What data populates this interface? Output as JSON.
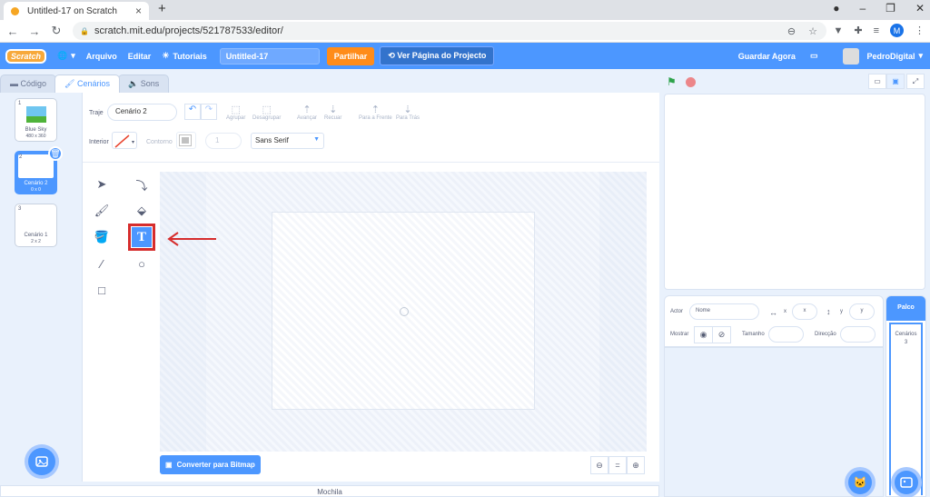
{
  "browser": {
    "tab_title": "Untitled-17 on Scratch",
    "url": "scratch.mit.edu/projects/521787533/editor/",
    "profile_initial": "M"
  },
  "menu": {
    "logo": "Scratch",
    "file": "Arquivo",
    "edit": "Editar",
    "tutorials": "Tutoriais",
    "project_title": "Untitled-17",
    "share": "Partilhar",
    "project_page": "Ver Página do Projecto",
    "save_now": "Guardar Agora",
    "username": "PedroDigital"
  },
  "tabs": {
    "code": "Código",
    "costumes": "Cenários",
    "sounds": "Sons"
  },
  "costumes": [
    {
      "num": "1",
      "name": "Blue Sky",
      "size": "480 x 360"
    },
    {
      "num": "2",
      "name": "Cenário 2",
      "size": "0 x 0"
    },
    {
      "num": "3",
      "name": "Cenário 1",
      "size": "2 x 2"
    }
  ],
  "paint": {
    "costume_label": "Traje",
    "costume_name": "Cenário 2",
    "group": "Agrupar",
    "ungroup": "Desagrupar",
    "forward": "Avançar",
    "backward": "Recuar",
    "front": "Para a Frente",
    "back": "Para Trás",
    "fill_label": "Interior",
    "outline_label": "Contorno",
    "outline_width": "1",
    "font": "Sans Serif",
    "convert_bitmap": "Converter para Bitmap",
    "zoom_reset": "="
  },
  "backpack": "Mochila",
  "sprite_info": {
    "sprite_label": "Actor",
    "name_placeholder": "Nome",
    "x_label": "x",
    "x_placeholder": "x",
    "y_label": "y",
    "y_placeholder": "y",
    "show_label": "Mostrar",
    "size_label": "Tamanho",
    "direction_label": "Direcção"
  },
  "stage_target": {
    "title": "Palco",
    "backdrops_label": "Cenários",
    "backdrops_count": "3"
  },
  "colors": {
    "accent": "#4c97ff",
    "highlight": "#d62d2d"
  }
}
